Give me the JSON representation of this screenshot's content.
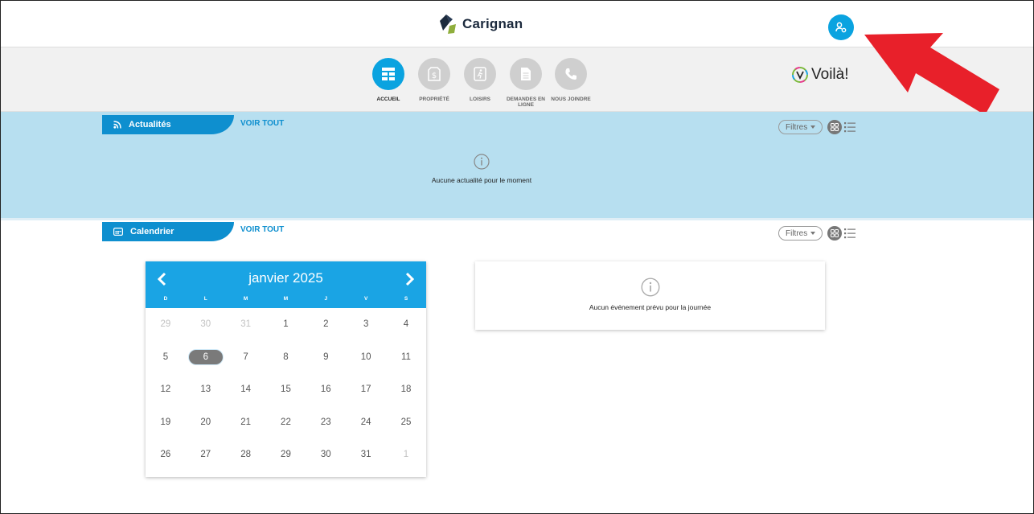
{
  "header": {
    "brand_name": "Carignan"
  },
  "nav": {
    "items": [
      {
        "label": "ACCUEIL",
        "icon": "home-grid-icon",
        "active": true
      },
      {
        "label": "PROPRIÉTÉ",
        "icon": "dollar-tag-icon",
        "active": false
      },
      {
        "label": "LOISIRS",
        "icon": "runner-icon",
        "active": false
      },
      {
        "label": "DEMANDES EN LIGNE",
        "icon": "document-icon",
        "active": false
      },
      {
        "label": "NOUS JOINDRE",
        "icon": "phone-icon",
        "active": false
      }
    ],
    "voila_label": "Voilà!"
  },
  "news": {
    "title": "Actualités",
    "see_all": "VOIR TOUT",
    "filters": "Filtres",
    "empty_message": "Aucune actualité pour le moment"
  },
  "calendar_section": {
    "title": "Calendrier",
    "see_all": "VOIR TOUT",
    "filters": "Filtres"
  },
  "calendar": {
    "month_label": "janvier 2025",
    "weekdays": [
      "D",
      "L",
      "M",
      "M",
      "J",
      "V",
      "S"
    ],
    "weeks": [
      [
        {
          "d": "29",
          "muted": true
        },
        {
          "d": "30",
          "muted": true
        },
        {
          "d": "31",
          "muted": true
        },
        {
          "d": "1"
        },
        {
          "d": "2"
        },
        {
          "d": "3"
        },
        {
          "d": "4"
        }
      ],
      [
        {
          "d": "5"
        },
        {
          "d": "6",
          "today": true
        },
        {
          "d": "7"
        },
        {
          "d": "8"
        },
        {
          "d": "9"
        },
        {
          "d": "10"
        },
        {
          "d": "11"
        }
      ],
      [
        {
          "d": "12"
        },
        {
          "d": "13"
        },
        {
          "d": "14"
        },
        {
          "d": "15"
        },
        {
          "d": "16"
        },
        {
          "d": "17"
        },
        {
          "d": "18"
        }
      ],
      [
        {
          "d": "19"
        },
        {
          "d": "20"
        },
        {
          "d": "21"
        },
        {
          "d": "22"
        },
        {
          "d": "23"
        },
        {
          "d": "24"
        },
        {
          "d": "25"
        }
      ],
      [
        {
          "d": "26"
        },
        {
          "d": "27"
        },
        {
          "d": "28"
        },
        {
          "d": "29"
        },
        {
          "d": "30"
        },
        {
          "d": "31"
        },
        {
          "d": "1",
          "muted": true
        }
      ]
    ]
  },
  "events": {
    "empty_message": "Aucun événement prévu pour la journée"
  },
  "colors": {
    "accent": "#0aa3e0",
    "tab_blue": "#0e8fcf",
    "news_band": "#b7dff0",
    "arrow": "#e8202a"
  }
}
